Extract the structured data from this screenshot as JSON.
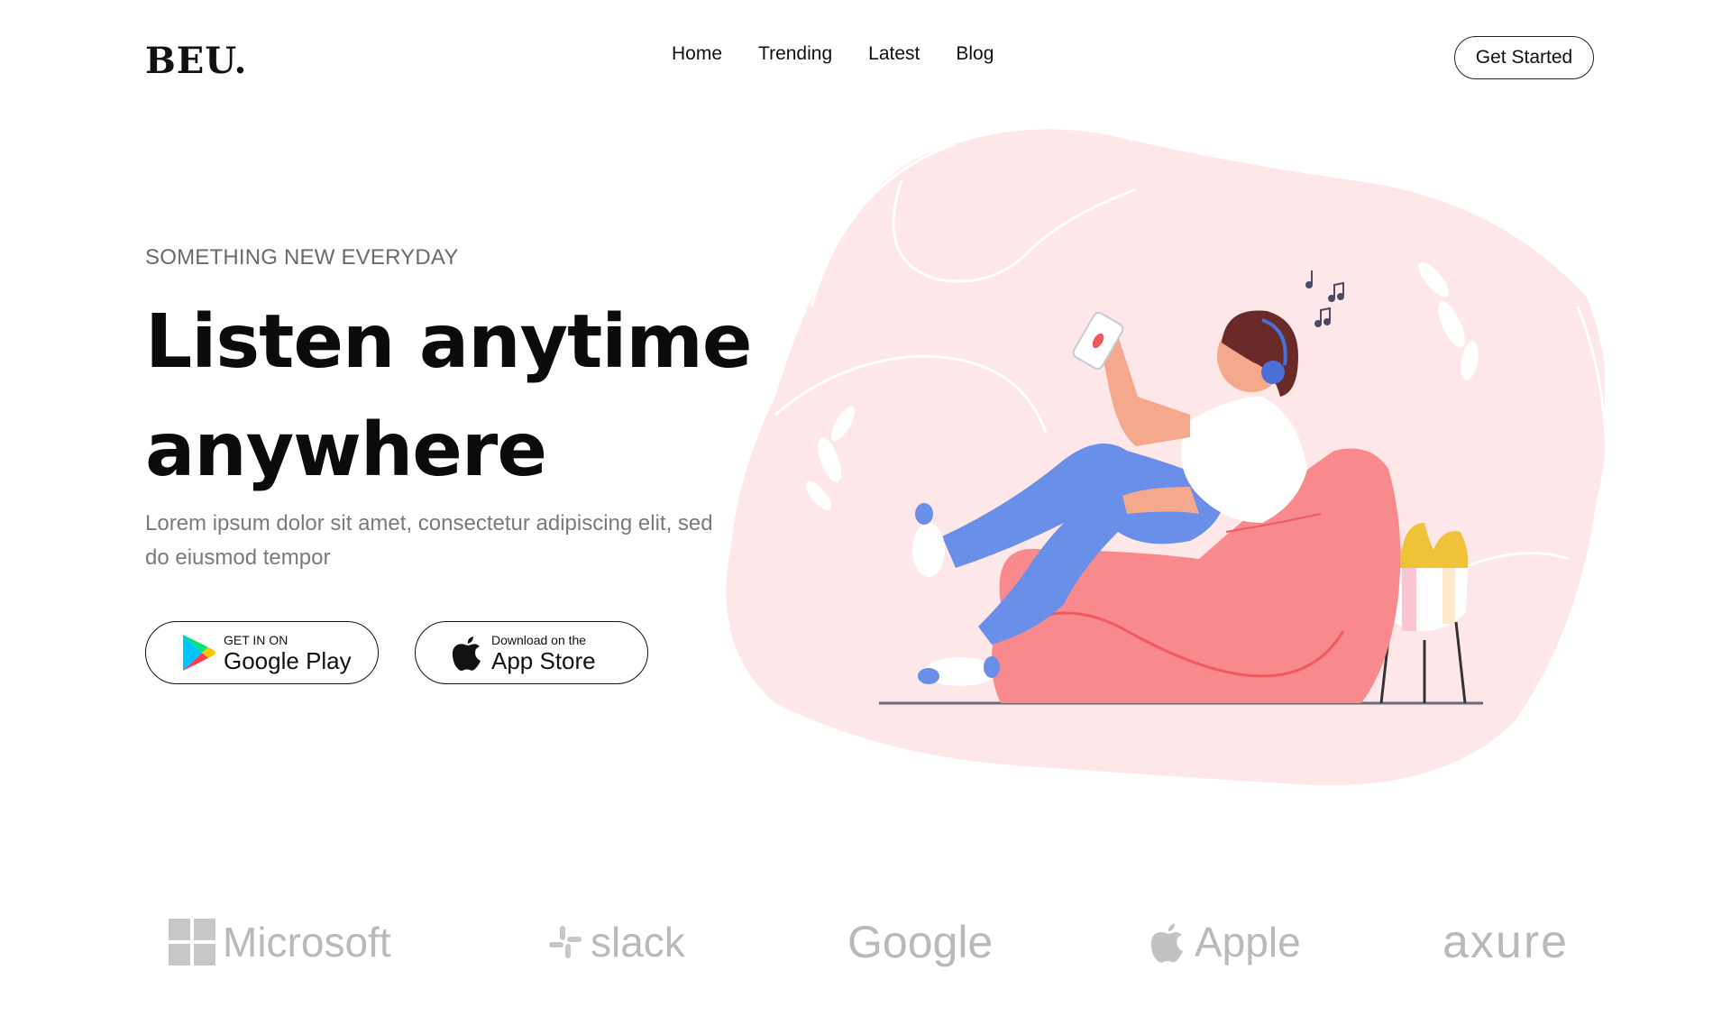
{
  "header": {
    "logo": "BEU.",
    "nav": [
      "Home",
      "Trending",
      "Latest",
      "Blog"
    ],
    "cta_label": "Get Started"
  },
  "hero": {
    "kicker": "SOMETHING NEW EVERYDAY",
    "headline_line1": "Listen anytime",
    "headline_line2": "anywhere",
    "description": "Lorem ipsum dolor sit amet, consectetur adipiscing elit, sed do eiusmod tempor",
    "google_play": {
      "small": "GET IN ON",
      "big": "Google Play"
    },
    "app_store": {
      "small": "Download on the",
      "big": "App Store"
    }
  },
  "brands": [
    "Microsoft",
    "slack",
    "Google",
    "Apple",
    "axure"
  ],
  "colors": {
    "blob": "#fde8e8",
    "beanbag": "#f7888b",
    "jeans": "#6a8fe8",
    "plant": "#f0c23a",
    "brand_gray": "#b9b9b9"
  }
}
